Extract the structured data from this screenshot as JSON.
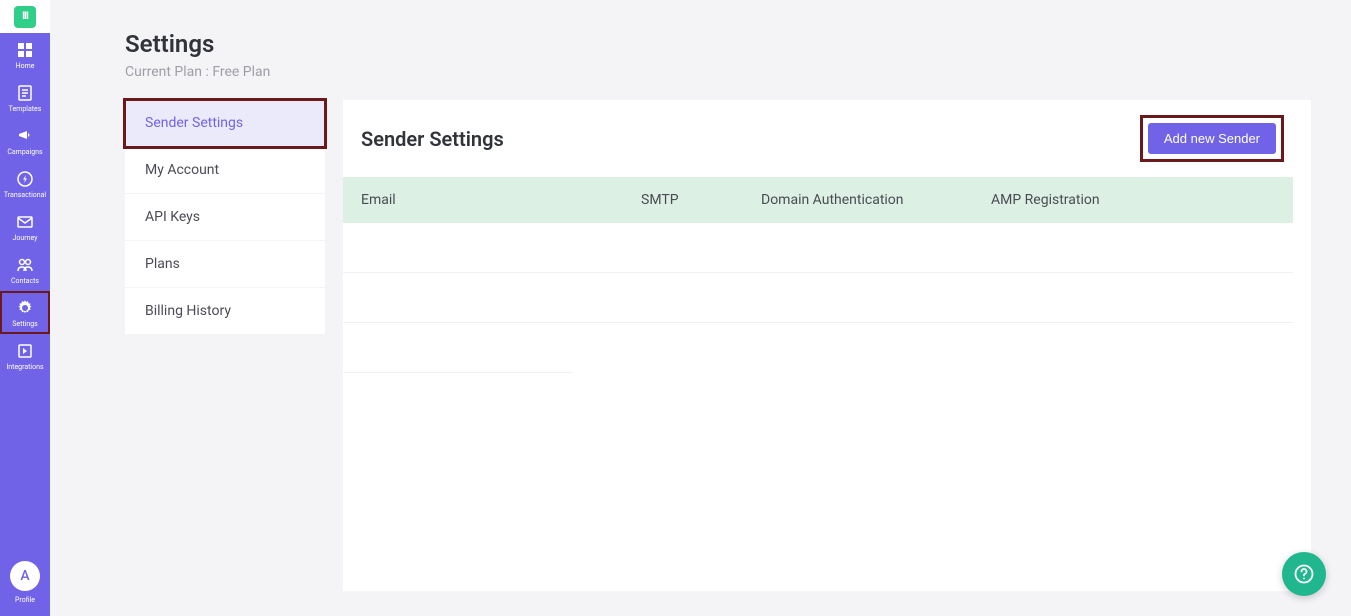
{
  "sidebar": {
    "items": [
      {
        "label": "Home"
      },
      {
        "label": "Templates"
      },
      {
        "label": "Campaigns"
      },
      {
        "label": "Transactional"
      },
      {
        "label": "Journey"
      },
      {
        "label": "Contacts"
      },
      {
        "label": "Settings"
      },
      {
        "label": "Integrations"
      }
    ],
    "avatar_letter": "A",
    "profile_label": "Profile"
  },
  "header": {
    "title": "Settings",
    "subtitle": "Current Plan : Free Plan"
  },
  "settings_menu": [
    "Sender Settings",
    "My Account",
    "API Keys",
    "Plans",
    "Billing History"
  ],
  "panel": {
    "title": "Sender Settings",
    "add_button": "Add new Sender",
    "columns": [
      "Email",
      "SMTP",
      "Domain Authentication",
      "AMP Registration"
    ]
  },
  "help_char": "?"
}
